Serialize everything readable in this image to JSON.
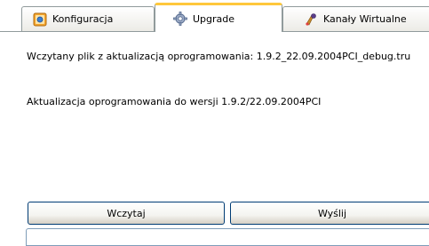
{
  "tabs": [
    {
      "label": "Konfiguracja",
      "icon": "configuration-icon",
      "active": false
    },
    {
      "label": "Upgrade",
      "icon": "gear-icon",
      "active": true
    },
    {
      "label": "Kanały Wirtualne",
      "icon": "virtual-channels-icon",
      "active": false
    }
  ],
  "upgrade": {
    "loaded_file_text": "Wczytany plik z aktualizacją oprogramowania: 1.9.2_22.09.2004PCI_debug.tru",
    "firmware_version_text": "Aktualizacja oprogramowania do wersji 1.9.2/22.09.2004PCI",
    "load_button_label": "Wczytaj",
    "send_button_label": "Wyślij"
  },
  "colors": {
    "active_tab_accent": "#ffc83c",
    "button_border": "#003c74",
    "tab_border": "#919b9c"
  }
}
